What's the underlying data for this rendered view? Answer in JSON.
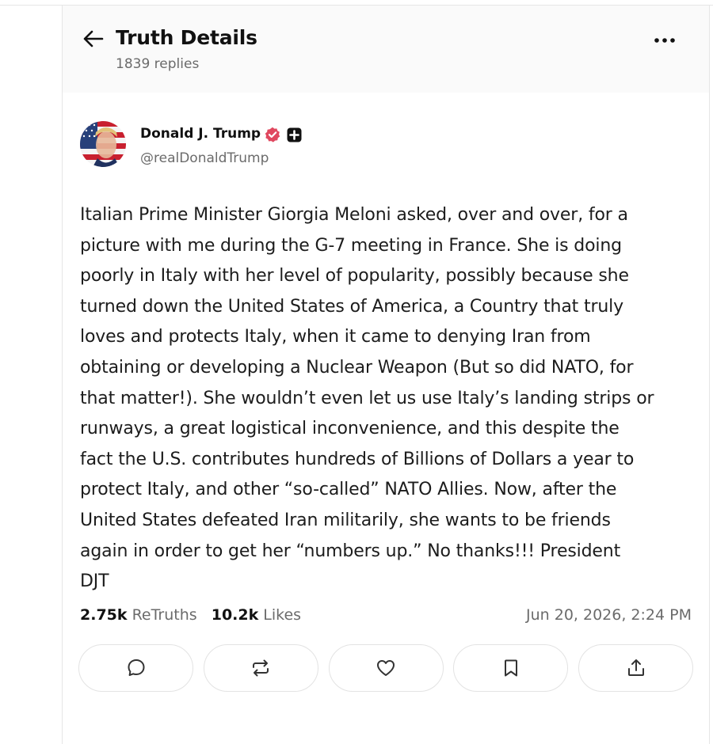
{
  "header": {
    "title": "Truth Details",
    "replies": "1839 replies"
  },
  "post": {
    "author_name": "Donald J. Trump",
    "handle": "@realDonaldTrump",
    "body": "Italian Prime Minister Giorgia Meloni asked, over and over, for a\npicture with me during the G-7 meeting in France. She is doing\npoorly in Italy with her level of popularity, possibly because she\nturned down the United States of America, a Country that truly\nloves and protects Italy, when it came to denying Iran from\nobtaining or developing a Nuclear Weapon (But so did NATO, for\nthat matter!). She wouldn’t even let us use Italy’s landing strips or\nrunways, a great logistical inconvenience, and this despite the\nfact the U.S. contributes hundreds of Billions of Dollars a year to\nprotect Italy, and other “so-called” NATO Allies. Now, after the\nUnited States defeated Iran militarily, she wants to be friends\nagain in order to get her “numbers up.” No thanks!!! President\nDJT",
    "retruths_count": "2.75k",
    "retruths_label": "ReTruths",
    "likes_count": "10.2k",
    "likes_label": "Likes",
    "timestamp": "Jun 20, 2026, 2:24 PM"
  },
  "icons": {
    "back": "arrow-left-icon",
    "more": "more-horizontal-icon",
    "verified": "verified-badge-icon",
    "plus": "plus-badge-icon",
    "reply": "comment-icon",
    "retruth": "repost-icon",
    "like": "heart-icon",
    "bookmark": "bookmark-icon",
    "share": "share-icon"
  },
  "colors": {
    "verified": "#e0485f",
    "text": "#111111",
    "muted": "#6b6b6b",
    "border": "#e3e3e3"
  }
}
